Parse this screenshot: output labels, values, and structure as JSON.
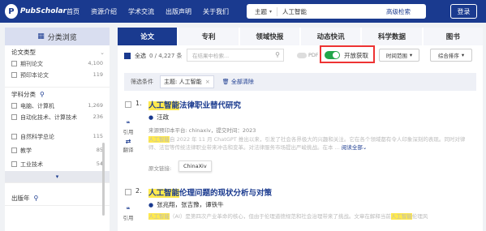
{
  "header": {
    "logo_text": "PubScholar",
    "nav": [
      "首页",
      "资源介绍",
      "学术交流",
      "出版声明",
      "关于我们"
    ],
    "search_field": "主题",
    "search_value": "人工智能",
    "advanced_label": "高级检索",
    "login_label": "登录"
  },
  "sidebar": {
    "title": "分类浏览",
    "doc_type": {
      "heading": "论文类型",
      "items": [
        {
          "label": "期刊论文",
          "count": "4,100"
        },
        {
          "label": "预印本论文",
          "count": "119"
        }
      ]
    },
    "subject": {
      "heading": "学科分类",
      "items": [
        {
          "label": "电脑、计算机",
          "count": "1,269"
        },
        {
          "label": "自动化技术、计算技术",
          "count": "236"
        },
        {
          "label": "自然科学总论",
          "count": "115"
        },
        {
          "label": "教学",
          "count": "85"
        },
        {
          "label": "工业技术",
          "count": "54"
        }
      ]
    },
    "year_heading": "出版年"
  },
  "tabs": [
    "论文",
    "专利",
    "领域快报",
    "动态快讯",
    "科学数据",
    "图书"
  ],
  "toolbar": {
    "select_all": "全选",
    "count": "0 / 4,227 条",
    "search_placeholder": "在结果中检索...",
    "pdf_label": "PDF",
    "oa_label": "开放获取",
    "time_range": "时间范围",
    "sort": "综合排序"
  },
  "filter": {
    "label": "筛选条件",
    "chip": "主题: 人工智能",
    "clear": "全部清除"
  },
  "results": [
    {
      "num": "1.",
      "title_hl": "人工智能",
      "title_rest": "法律职业替代研究",
      "author": "汪政",
      "source": "来源预印本平台:  chinaxiv，提交时间：2023",
      "abstract_hl": "人工智能",
      "abstract_rest": "自 2022 年 11 月 ChatGPT 推出以来，引发了社会各界极大的兴趣和关注。它在各个领域都有令人印象深刻的表现。同时对律师、法官等传统法律职业带来冲击和变革。对法律服务市场提出严峻挑战。在本 ...",
      "more": "阅读全部",
      "acts": [
        "引用",
        "翻译"
      ],
      "link_label": "原文链接:",
      "link_chip": "ChinaXiv"
    },
    {
      "num": "2.",
      "title_hl": "人工智能",
      "title_rest": "伦理问题的现状分析与对策",
      "author": "张兆翔，张吉豫，谭铁牛",
      "abstract_hl": "人工智能",
      "abstract_rest": "（AI）是第四次产业革命的核心，但由于伦理道德规范和社会治理带来了挑战。文章在解释当前",
      "abstract_tail_hl": "人工智能",
      "abstract_tail": "伦理风",
      "acts": [
        "引用"
      ]
    }
  ]
}
